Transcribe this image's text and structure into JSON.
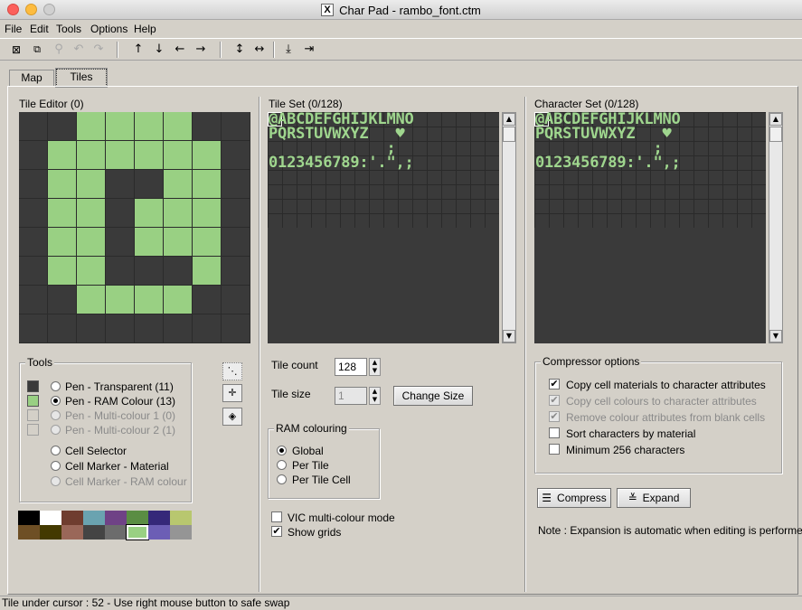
{
  "window": {
    "title": "Char Pad - rambo_font.ctm",
    "app_glyph": "X"
  },
  "menu": [
    "File",
    "Edit",
    "Tools",
    "Options",
    "Help"
  ],
  "toolbar_icons": [
    "clear-icon",
    "split-icon",
    "pin-icon",
    "undo-icon",
    "redo-icon",
    "arrow-up-icon",
    "arrow-down-icon",
    "arrow-left-icon",
    "arrow-right-icon",
    "flip-vertical-icon",
    "flip-horizontal-icon",
    "rotate-down-icon",
    "rotate-right-icon"
  ],
  "tabs": [
    {
      "label": "Map",
      "active": false
    },
    {
      "label": "Tiles",
      "active": true
    }
  ],
  "tile_editor": {
    "label": "Tile Editor (0)",
    "rows": [
      "00111100",
      "01111110",
      "01100110",
      "01101110",
      "01101110",
      "01100010",
      "00111100",
      "00000000"
    ],
    "on_color": "#99d083",
    "off_color": "#3a3a3a"
  },
  "tile_set": {
    "label": "Tile Set (0/128)",
    "rows": [
      "@ABCDEFGHIJKLMNO",
      "PQRSTUVWXYZ   ♥",
      "             ; ",
      "0123456789:'.\",;"
    ]
  },
  "char_set": {
    "label": "Character Set (0/128)",
    "rows": [
      "@ABCDEFGHIJKLMNO",
      "PQRSTUVWXYZ   ♥",
      "             ; ",
      "0123456789:'.\",;"
    ]
  },
  "tools": {
    "title": "Tools",
    "pens": [
      {
        "label": "Pen - Transparent (11)",
        "checked": false,
        "enabled": true,
        "color": "#3a3a3a"
      },
      {
        "label": "Pen - RAM Colour (13)",
        "checked": true,
        "enabled": true,
        "color": "#99d083"
      },
      {
        "label": "Pen - Multi-colour 1 (0)",
        "checked": false,
        "enabled": false,
        "color": "#d4d0c8"
      },
      {
        "label": "Pen - Multi-colour 2 (1)",
        "checked": false,
        "enabled": false,
        "color": "#d4d0c8"
      }
    ],
    "modes": [
      {
        "label": "Cell Selector",
        "checked": false,
        "enabled": true
      },
      {
        "label": "Cell Marker - Material",
        "checked": false,
        "enabled": true
      },
      {
        "label": "Cell Marker - RAM colour",
        "checked": false,
        "enabled": false
      }
    ]
  },
  "palette": [
    "#000000",
    "#ffffff",
    "#6f3d2f",
    "#6aa3b0",
    "#6f4286",
    "#5a8d43",
    "#352879",
    "#b8c76f",
    "#6e4f25",
    "#433900",
    "#9a6759",
    "#444444",
    "#6c6c6c",
    "#99d083",
    "#6c5eb5",
    "#959595"
  ],
  "tile_count": {
    "label": "Tile count",
    "value": "128"
  },
  "tile_size": {
    "label": "Tile size",
    "value": "1",
    "button": "Change Size"
  },
  "ram_colouring": {
    "title": "RAM colouring",
    "options": [
      {
        "label": "Global",
        "checked": true
      },
      {
        "label": "Per Tile",
        "checked": false
      },
      {
        "label": "Per Tile Cell",
        "checked": false
      }
    ]
  },
  "vic_mode": {
    "label": "VIC multi-colour mode",
    "checked": false
  },
  "show_grids": {
    "label": "Show grids",
    "checked": true
  },
  "compressor": {
    "title": "Compressor options",
    "options": [
      {
        "label": "Copy cell materials to character attributes",
        "checked": true,
        "enabled": true
      },
      {
        "label": "Copy cell colours to character attributes",
        "checked": true,
        "enabled": false
      },
      {
        "label": "Remove colour attributes from blank cells",
        "checked": true,
        "enabled": false
      },
      {
        "label": "Sort characters by material",
        "checked": false,
        "enabled": true
      },
      {
        "label": "Minimum 256 characters",
        "checked": false,
        "enabled": true
      }
    ],
    "compress_label": "Compress",
    "expand_label": "Expand",
    "note": "Note : Expansion is automatic when editing is performed."
  },
  "status": "Tile under cursor : 52 - Use right mouse button to safe swap"
}
